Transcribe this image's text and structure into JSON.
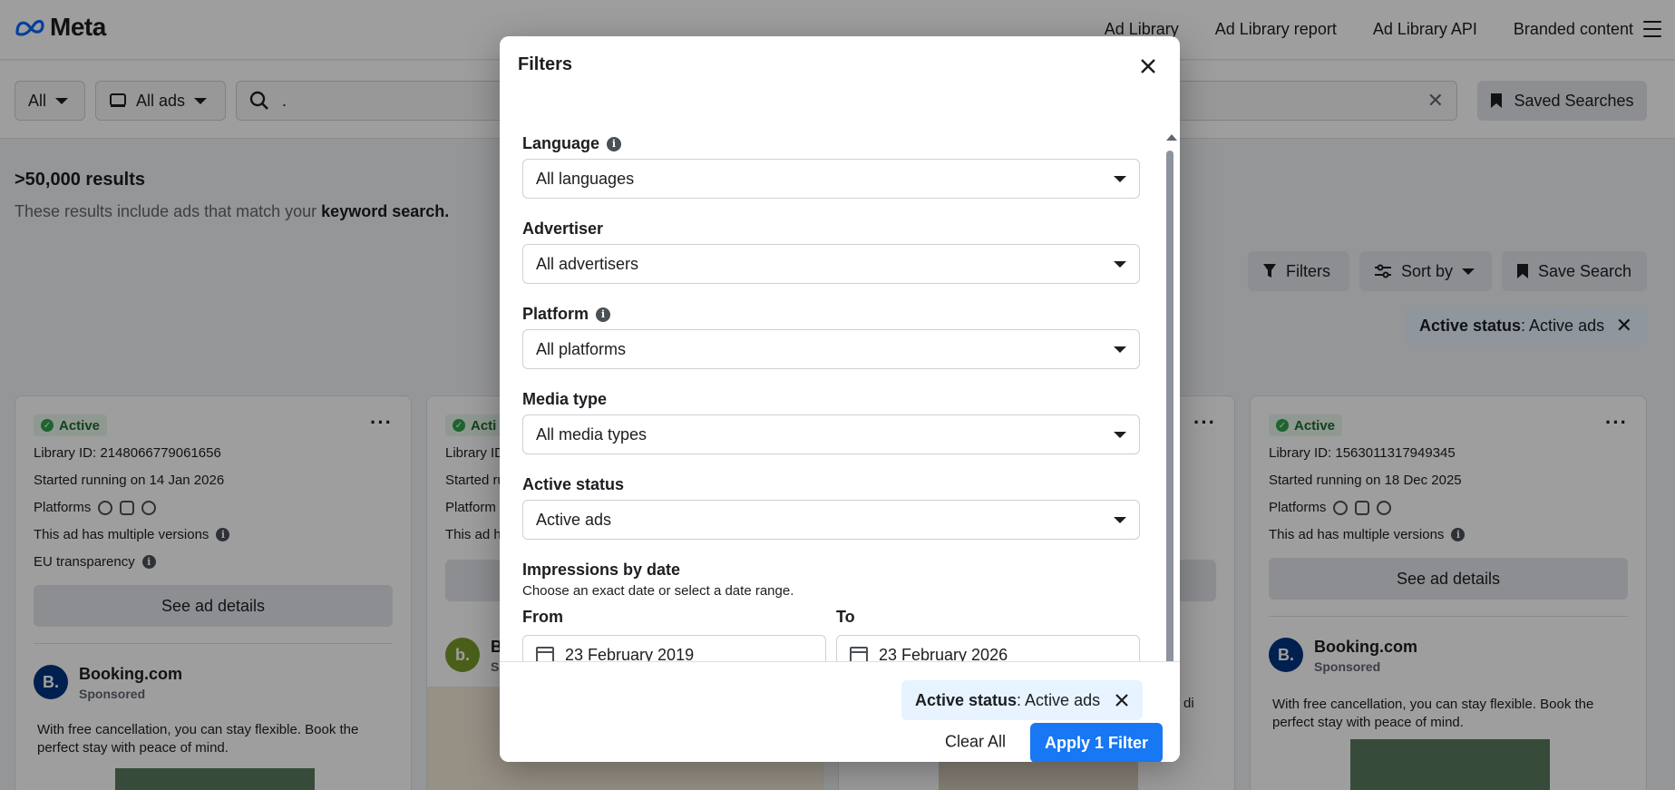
{
  "header": {
    "logo_text": "Meta",
    "nav": [
      "Ad Library",
      "Ad Library report",
      "Ad Library API",
      "Branded content"
    ]
  },
  "searchbar": {
    "country_label": "All",
    "ad_type_label": "All ads",
    "query_value": ".",
    "saved_searches_label": "Saved Searches"
  },
  "results": {
    "count": ">50,000 results",
    "note_prefix": "These results include ads that match your ",
    "note_bold": "keyword search."
  },
  "actions": {
    "filters_label": "Filters",
    "sort_label": "Sort by",
    "save_search_label": "Save Search",
    "chip_key": "Active status",
    "chip_value": ": Active ads"
  },
  "cards": [
    {
      "status": "Active",
      "library_id": "Library ID: 2148066779061656",
      "started": "Started running on 14 Jan 2026",
      "platforms_label": "Platforms",
      "versions": "This ad has multiple versions",
      "eu": "EU transparency",
      "details_label": "See ad details",
      "advertiser": "Booking.com",
      "sponsored": "Sponsored",
      "text": "With free cancellation, you can stay flexible. Book the perfect stay with peace of mind."
    },
    {
      "status": "Acti",
      "library_id": "Library ID",
      "started": "Started ru",
      "platforms_label": "Platform",
      "versions": "This ad h",
      "advertiser": "B",
      "sponsored": "S"
    },
    {
      "tail_text": "di"
    },
    {
      "status": "Active",
      "library_id": "Library ID: 1563011317949345",
      "started": "Started running on 18 Dec 2025",
      "platforms_label": "Platforms",
      "versions": "This ad has multiple versions",
      "details_label": "See ad details",
      "advertiser": "Booking.com",
      "sponsored": "Sponsored",
      "text": "With free cancellation, you can stay flexible. Book the perfect stay with peace of mind."
    }
  ],
  "modal": {
    "title": "Filters",
    "fields": {
      "language": {
        "label": "Language",
        "value": "All languages"
      },
      "advertiser": {
        "label": "Advertiser",
        "value": "All advertisers"
      },
      "platform": {
        "label": "Platform",
        "value": "All platforms"
      },
      "media_type": {
        "label": "Media type",
        "value": "All media types"
      },
      "active_status": {
        "label": "Active status",
        "value": "Active ads"
      }
    },
    "impressions": {
      "label": "Impressions by date",
      "subtitle": "Choose an exact date or select a date range.",
      "from_label": "From",
      "to_label": "To",
      "from_value": "23 February 2019",
      "to_value": "23 February 2026"
    },
    "footer": {
      "chip_key": "Active status",
      "chip_value": ": Active ads",
      "clear_all": "Clear All",
      "apply": "Apply 1 Filter"
    }
  },
  "colors": {
    "primary": "#1877f2",
    "chip_bg": "#e7f3ff",
    "active_green": "#31a24c"
  }
}
